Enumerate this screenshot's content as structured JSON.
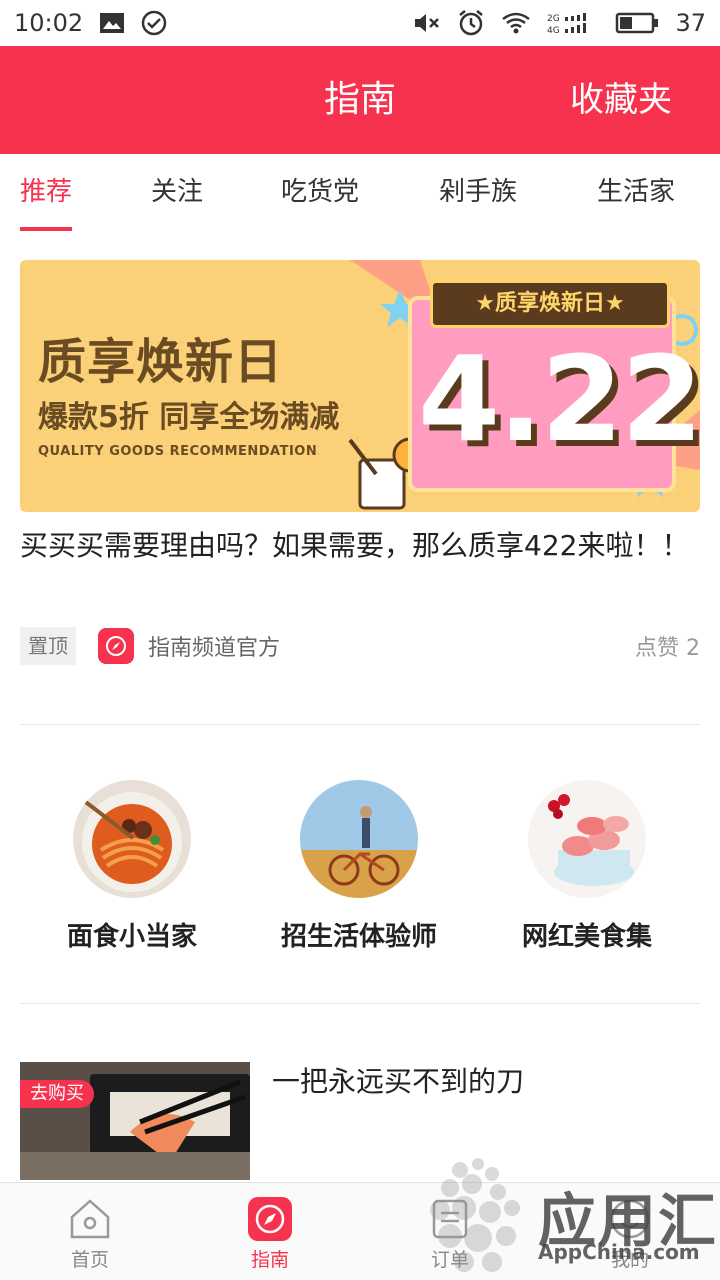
{
  "status_bar": {
    "time": "10:02",
    "battery": "37",
    "icons": [
      "image-icon",
      "check-circle-icon",
      "mute-icon",
      "alarm-icon",
      "wifi-icon",
      "signal-icon",
      "battery-icon"
    ]
  },
  "header": {
    "title": "指南",
    "right_action": "收藏夹"
  },
  "tabs": [
    {
      "label": "推荐",
      "active": true
    },
    {
      "label": "关注",
      "active": false
    },
    {
      "label": "吃货党",
      "active": false
    },
    {
      "label": "剁手族",
      "active": false
    },
    {
      "label": "生活家",
      "active": false
    }
  ],
  "banner": {
    "title": "质享焕新日",
    "subtitle": "爆款5折 同享全场满减",
    "english": "QUALITY GOODS RECOMMENDATION",
    "ribbon": "★质享焕新日★",
    "big_date": "4.22"
  },
  "article": {
    "title": "买买买需要理由吗？如果需要，那么质享422来啦！！",
    "pin_label": "置顶",
    "channel": "指南频道官方",
    "likes": "点赞 2"
  },
  "categories": [
    {
      "label": "面食小当家",
      "icon": "noodles-photo"
    },
    {
      "label": "招生活体验师",
      "icon": "bicycle-photo"
    },
    {
      "label": "网红美食集",
      "icon": "macarons-photo"
    }
  ],
  "product": {
    "badge": "去购买",
    "title": "一把永远买不到的刀"
  },
  "bottom_nav": [
    {
      "label": "首页",
      "icon": "home-icon",
      "active": false
    },
    {
      "label": "指南",
      "icon": "compass-icon",
      "active": true
    },
    {
      "label": "订单",
      "icon": "order-icon",
      "active": false
    },
    {
      "label": "我的",
      "icon": "profile-icon",
      "active": false
    }
  ],
  "watermark": {
    "text": "应用汇",
    "sub": "AppChina.com"
  },
  "colors": {
    "brand": "#f7324e",
    "banner_bg": "#fbd27a",
    "banner_brown": "#6a4b22"
  }
}
